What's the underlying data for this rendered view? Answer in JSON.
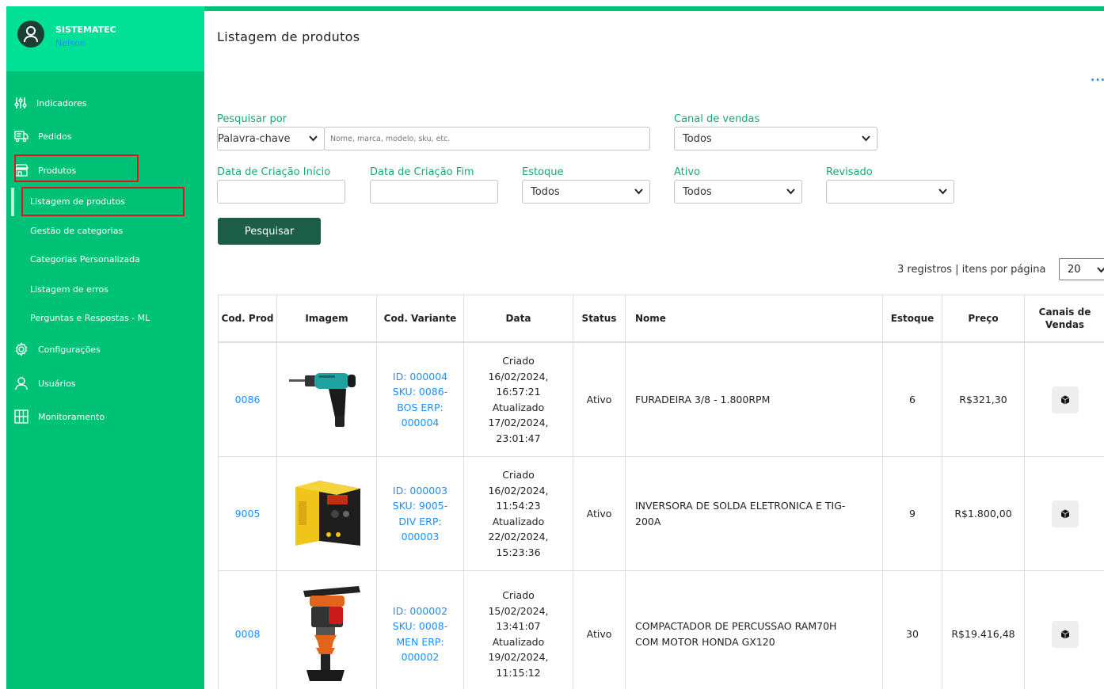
{
  "sidebar": {
    "company": "SISTEMATEC",
    "username": "Nelson",
    "items": [
      {
        "label": "Indicadores",
        "icon": "sliders-icon"
      },
      {
        "label": "Pedidos",
        "icon": "delivery-icon"
      },
      {
        "label": "Produtos",
        "icon": "store-icon"
      },
      {
        "label": "Configurações",
        "icon": "gear-icon"
      },
      {
        "label": "Usuários",
        "icon": "user-icon"
      },
      {
        "label": "Monitoramento",
        "icon": "monitor-grid-icon"
      }
    ],
    "subitems": [
      {
        "label": "Listagem de produtos"
      },
      {
        "label": "Gestão de categorias"
      },
      {
        "label": "Categorias Personalizada"
      },
      {
        "label": "Listagem de erros"
      },
      {
        "label": "Perguntas e Respostas - ML"
      }
    ],
    "accent_color": "#00c277"
  },
  "page": {
    "title": "Listagem de produtos",
    "more": "..."
  },
  "filters": {
    "search_by_label": "Pesquisar por",
    "search_by_value": "Palavra-chave",
    "search_placeholder": "Nome, marca, modelo, sku, etc.",
    "channel_label": "Canal de vendas",
    "channel_value": "Todos",
    "date_start_label": "Data de Criação Início",
    "date_end_label": "Data de Criação Fim",
    "stock_label": "Estoque",
    "stock_value": "Todos",
    "active_label": "Ativo",
    "active_value": "Todos",
    "revised_label": "Revisado",
    "revised_value": "",
    "search_button": "Pesquisar"
  },
  "pagination": {
    "records_text": "3 registros | itens por página",
    "per_page": "20"
  },
  "table": {
    "headers": {
      "cod_prod": "Cod. Prod",
      "imagem": "Imagem",
      "cod_variante": "Cod. Variante",
      "data": "Data",
      "status": "Status",
      "nome": "Nome",
      "estoque": "Estoque",
      "preco": "Preço",
      "canais": "Canais de Vendas"
    },
    "rows": [
      {
        "cod": "0086",
        "image": "drill",
        "variante": "ID: 000004 SKU: 0086-BOS ERP: 000004",
        "data": "Criado 16/02/2024, 16:57:21 Atualizado 17/02/2024, 23:01:47",
        "status": "Ativo",
        "nome": "FURADEIRA 3/8 - 1.800RPM",
        "estoque": "6",
        "preco": "R$321,30"
      },
      {
        "cod": "9005",
        "image": "welder",
        "variante": "ID: 000003 SKU: 9005-DIV ERP: 000003",
        "data": "Criado 16/02/2024, 11:54:23 Atualizado 22/02/2024, 15:23:36",
        "status": "Ativo",
        "nome": "INVERSORA DE SOLDA ELETRONICA E TIG-200A",
        "estoque": "9",
        "preco": "R$1.800,00"
      },
      {
        "cod": "0008",
        "image": "rammer",
        "variante": "ID: 000002 SKU: 0008-MEN ERP: 000002",
        "data": "Criado 15/02/2024, 13:41:07 Atualizado 19/02/2024, 11:15:12",
        "status": "Ativo",
        "nome": "COMPACTADOR DE PERCUSSAO RAM70H COM MOTOR HONDA GX120",
        "estoque": "30",
        "preco": "R$19.416,48"
      }
    ]
  }
}
